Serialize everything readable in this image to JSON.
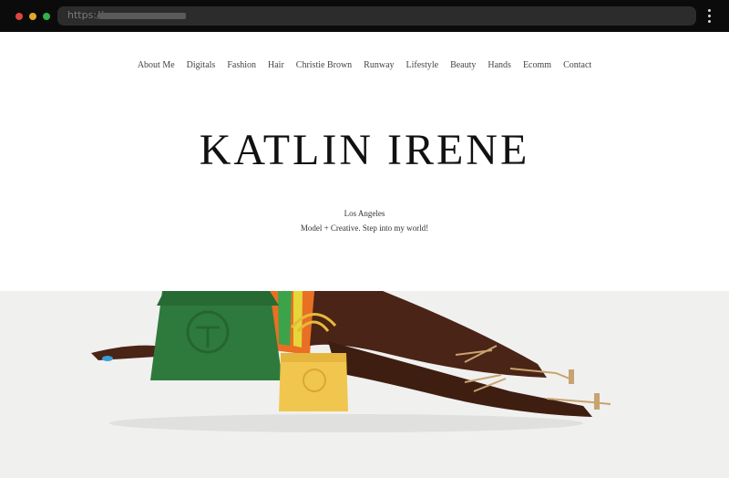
{
  "browser": {
    "url_prefix": "https://",
    "menu_icon": "kebab-menu-icon"
  },
  "nav": {
    "items": [
      {
        "label": "About Me"
      },
      {
        "label": "Digitals"
      },
      {
        "label": "Fashion"
      },
      {
        "label": "Hair"
      },
      {
        "label": "Christie Brown"
      },
      {
        "label": "Runway"
      },
      {
        "label": "Lifestyle"
      },
      {
        "label": "Beauty"
      },
      {
        "label": "Hands"
      },
      {
        "label": "Ecomm"
      },
      {
        "label": "Contact"
      }
    ]
  },
  "site": {
    "title": "KATLIN IRENE",
    "location": "Los Angeles",
    "tagline": "Model + Creative. Step into my world!"
  },
  "hero": {
    "alt": "model lying with green and yellow bags",
    "colors": {
      "background": "#ececeb",
      "green_bag": "#2e7a3c",
      "yellow_bag": "#f1c64e",
      "skin": "#4a2416",
      "sandal": "#c9a36f"
    }
  }
}
